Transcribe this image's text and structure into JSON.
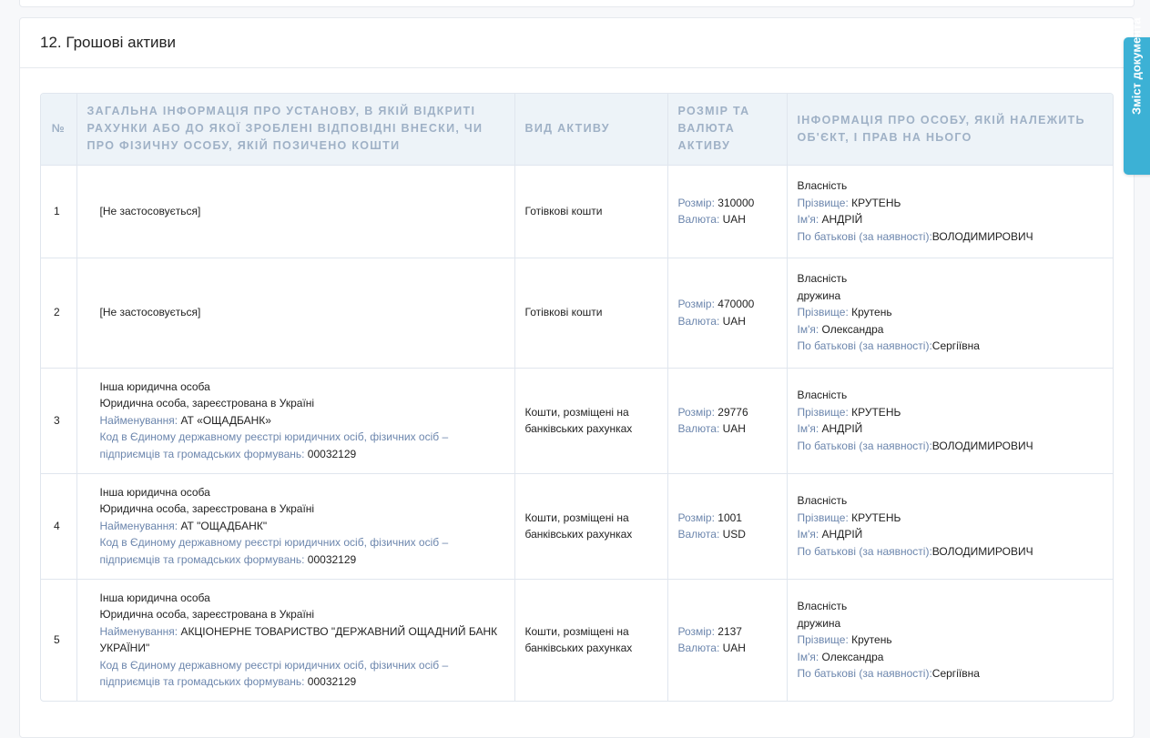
{
  "section": {
    "title": "12. Грошові активи"
  },
  "toc_tab": {
    "label": "Зміст документа"
  },
  "table": {
    "headers": {
      "num": "№",
      "institution": "Загальна інформація про установу, в якій відкриті рахунки або до якої зроблені відповідні внески, чи про фізичну особу, якій позичено кошти",
      "asset_type": "Вид активу",
      "amount": "Розмір та валюта активу",
      "owner": "Інформація про особу, якій належить об'єкт, і прав на нього"
    },
    "labels": {
      "name": "Найменування: ",
      "code": "Код в Єдиному державному реєстрі юридичних осіб, фізичних осіб – підприємців та громадських формувань: ",
      "size": "Розмір: ",
      "currency": "Валюта: ",
      "surname": "Прізвище: ",
      "first_name": "Ім'я: ",
      "patronymic": "По батькові (за наявності):"
    },
    "rows": [
      {
        "num": "1",
        "institution_text": "[Не застосовується]",
        "asset_type": "Готівкові кошти",
        "size": "310000",
        "currency": "UAH",
        "ownership": "Власність",
        "surname": "КРУТЕНЬ",
        "first_name": "АНДРІЙ",
        "patronymic": "ВОЛОДИМИРОВИЧ"
      },
      {
        "num": "2",
        "institution_text": "[Не застосовується]",
        "asset_type": "Готівкові кошти",
        "size": "470000",
        "currency": "UAH",
        "ownership": "Власність",
        "relation": "дружина",
        "surname": "Крутень",
        "first_name": "Олександра",
        "patronymic": "Сергіївна"
      },
      {
        "num": "3",
        "org_type": "Інша юридична особа",
        "org_registration": "Юридична особа, зареєстрована в Україні",
        "org_name": "АТ «ОЩАДБАНК»",
        "org_code": "00032129",
        "asset_type": "Кошти, розміщені на банківських рахунках",
        "size": "29776",
        "currency": "UAH",
        "ownership": "Власність",
        "surname": "КРУТЕНЬ",
        "first_name": "АНДРІЙ",
        "patronymic": "ВОЛОДИМИРОВИЧ"
      },
      {
        "num": "4",
        "org_type": "Інша юридична особа",
        "org_registration": "Юридична особа, зареєстрована в Україні",
        "org_name": "АТ \"ОЩАДБАНК\"",
        "org_code": "00032129",
        "asset_type": "Кошти, розміщені на банківських рахунках",
        "size": "1001",
        "currency": "USD",
        "ownership": "Власність",
        "surname": "КРУТЕНЬ",
        "first_name": "АНДРІЙ",
        "patronymic": "ВОЛОДИМИРОВИЧ"
      },
      {
        "num": "5",
        "org_type": "Інша юридична особа",
        "org_registration": "Юридична особа, зареєстрована в Україні",
        "org_name": "АКЦІОНЕРНЕ ТОВАРИСТВО \"ДЕРЖАВНИЙ ОЩАДНИЙ БАНК УКРАЇНИ\"",
        "org_code": "00032129",
        "asset_type": "Кошти, розміщені на банківських рахунках",
        "size": "2137",
        "currency": "UAH",
        "ownership": "Власність",
        "relation": "дружина",
        "surname": "Крутень",
        "first_name": "Олександра",
        "patronymic": "Сергіївна"
      }
    ]
  },
  "colors": {
    "label_blue": "#6c86ad",
    "header_bg": "#edf3f8",
    "header_text": "#9fb1c6",
    "toc_tab_bg": "#3cb1d5"
  }
}
